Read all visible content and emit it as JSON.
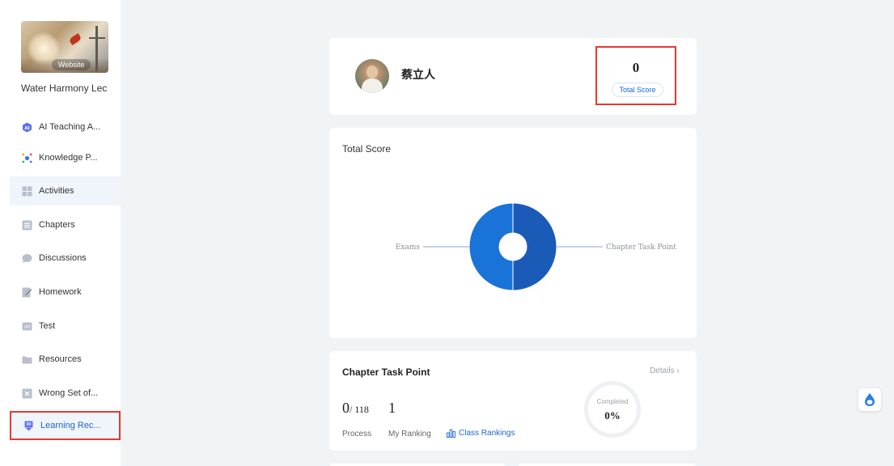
{
  "sidebar": {
    "cover_label": "Website",
    "course_title": "Water Harmony Lec",
    "items": [
      {
        "label": "AI Teaching A...",
        "icon": "ai-assistant-icon"
      },
      {
        "label": "Knowledge P...",
        "icon": "knowledge-graph-icon"
      },
      {
        "label": "Activities",
        "icon": "grid-icon"
      },
      {
        "label": "Chapters",
        "icon": "list-icon"
      },
      {
        "label": "Discussions",
        "icon": "chat-bubble-icon"
      },
      {
        "label": "Homework",
        "icon": "edit-document-icon"
      },
      {
        "label": "Test",
        "icon": "test-paper-icon"
      },
      {
        "label": "Resources",
        "icon": "folder-icon"
      },
      {
        "label": "Wrong Set of...",
        "icon": "wrong-set-icon"
      },
      {
        "label": "Learning Rec...",
        "icon": "learning-record-icon"
      }
    ]
  },
  "profile": {
    "name": "蔡立人",
    "total_score_value": "0",
    "total_score_label": "Total Score"
  },
  "score_chart": {
    "title": "Total Score"
  },
  "chart_data": {
    "type": "pie",
    "title": "Total Score",
    "categories": [
      "Exams",
      "Chapter Task Point"
    ],
    "values": [
      50,
      50
    ],
    "colors": [
      "#1a73d8",
      "#1a5bb8"
    ],
    "donut": true,
    "legend": "leader-lines"
  },
  "chapter_task": {
    "title": "Chapter Task Point",
    "details_label": "Details",
    "process_done": "0",
    "process_total": "/ 118",
    "ranking_value": "1",
    "process_label": "Process",
    "ranking_label": "My Ranking",
    "class_rankings_label": "Class Rankings",
    "completed_label": "Completed",
    "completed_value": "0%"
  },
  "colors": {
    "accent": "#1a66d6",
    "highlight_border": "#e23a32",
    "page_bg": "#f2f3f5"
  }
}
